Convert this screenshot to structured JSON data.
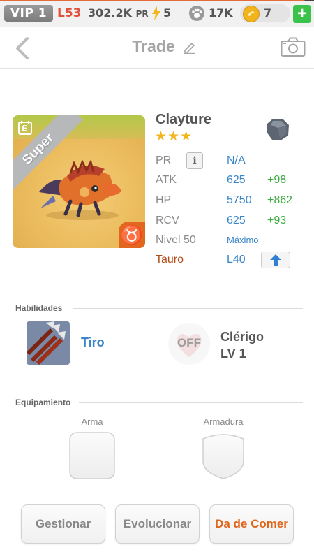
{
  "status_bar": {
    "vip": "VIP 1",
    "level": "L53",
    "power_value": "302.2K",
    "power_unit": "PR",
    "energy": "5",
    "paws": "17K",
    "coins": "7",
    "add_label": "+"
  },
  "header": {
    "title": "Trade",
    "icons": [
      "back-arrow-icon",
      "pencil-icon",
      "camera-icon"
    ]
  },
  "creature": {
    "name": "Clayture",
    "stars": "★★★",
    "rarity": "Super",
    "zodiac_symbol": "♉",
    "element": "earth",
    "stats": {
      "pr_label": "PR",
      "pr_info": "i",
      "pr_value": "N/A",
      "atk_label": "ATK",
      "atk_value": "625",
      "atk_bonus": "+98",
      "hp_label": "HP",
      "hp_value": "5750",
      "hp_bonus": "+862",
      "rcv_label": "RCV",
      "rcv_value": "625",
      "rcv_bonus": "+93",
      "level_label": "Nivel 50",
      "level_value": "Máximo",
      "zodiac_label": "Tauro",
      "zodiac_level": "L40"
    }
  },
  "skills": {
    "section_title": "Habilidades",
    "skill_name": "Tiro",
    "spirit_state": "OFF",
    "spirit_name": "Clérigo",
    "spirit_level": "LV 1"
  },
  "equipment": {
    "section_title": "Equipamiento",
    "weapon_label": "Arma",
    "armor_label": "Armadura"
  },
  "actions": {
    "manage": "Gestionar",
    "evolve": "Evolucionar",
    "feed": "Da de Comer"
  },
  "colors": {
    "accent_blue": "#3a86c8",
    "bonus_green": "#3aaa3f",
    "feed_orange": "#e0661c",
    "zodiac_brown": "#b24b18"
  }
}
